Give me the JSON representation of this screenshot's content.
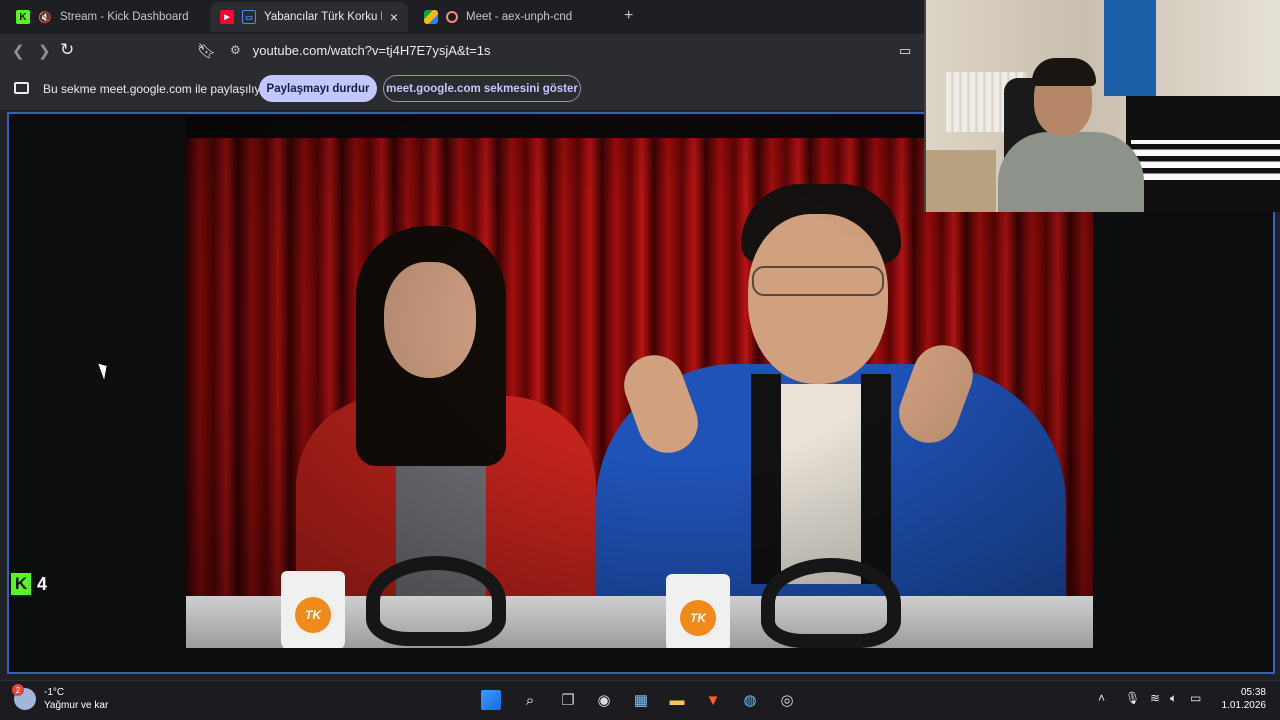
{
  "tabs": [
    {
      "title": "Stream - Kick Dashboard",
      "favicon": "kick-icon",
      "muted": true
    },
    {
      "title": "Yabancılar Türk Korku Filmleri",
      "favicon": "youtube-icon",
      "active": true
    },
    {
      "title": "Meet - aex-unph-cnd",
      "favicon": "meet-icon",
      "recording": true
    }
  ],
  "tab_close": "×",
  "new_tab": "+",
  "address": {
    "url": "youtube.com/watch?v=tj4H7E7ysjA&t=1s"
  },
  "share_bar": {
    "message": "Bu sekme meet.google.com ile paylaşılıyor",
    "stop_label": "Paylaşmayı durdur",
    "show_label": "meet.google.com sekmesini göster"
  },
  "video": {
    "mug_logo": "TK"
  },
  "kick_badge": {
    "letter": "K",
    "count": "4"
  },
  "weather": {
    "badge": "2",
    "temperature": "-1°C",
    "condition": "Yağmur ve kar"
  },
  "clock": {
    "time": "05:38",
    "date": "1.01.2026"
  },
  "colors": {
    "kick_green": "#53fc18",
    "accent_pill": "#c2c7ff",
    "share_border": "#3b5fc0",
    "curtain_red": "#a20e0e"
  }
}
